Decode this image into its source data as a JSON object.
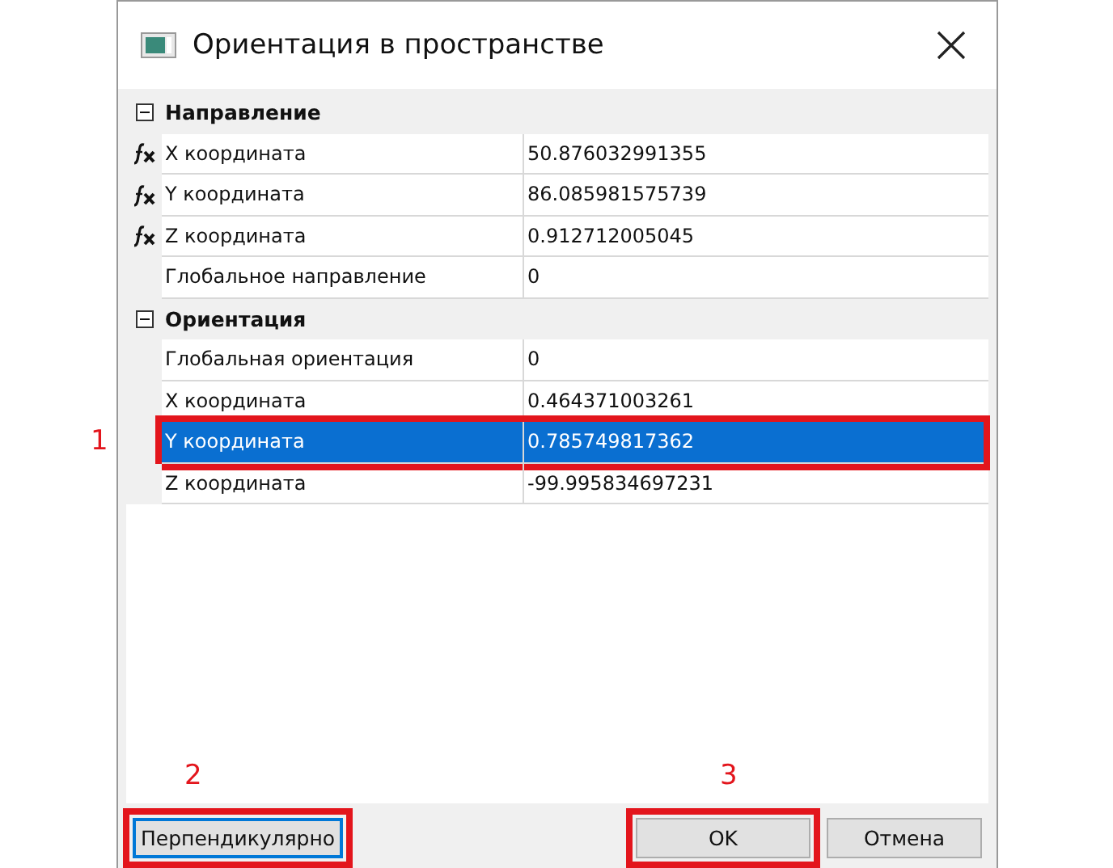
{
  "window": {
    "title": "Ориентация в пространстве"
  },
  "sections": [
    {
      "title": "Направление",
      "expanded": true,
      "rows": [
        {
          "name": "X координата",
          "value": "50.876032991355",
          "formula": true,
          "selected": false
        },
        {
          "name": "Y координата",
          "value": "86.085981575739",
          "formula": true,
          "selected": false
        },
        {
          "name": "Z координата",
          "value": "0.912712005045",
          "formula": true,
          "selected": false
        },
        {
          "name": "Глобальное направление",
          "value": "0",
          "formula": false,
          "selected": false
        }
      ]
    },
    {
      "title": "Ориентация",
      "expanded": true,
      "rows": [
        {
          "name": "Глобальная ориентация",
          "value": "0",
          "formula": false,
          "selected": false
        },
        {
          "name": "X координата",
          "value": "0.464371003261",
          "formula": false,
          "selected": false
        },
        {
          "name": "Y координата",
          "value": "0.785749817362",
          "formula": false,
          "selected": true,
          "annotation": "1"
        },
        {
          "name": "Z координата",
          "value": "-99.995834697231",
          "formula": false,
          "selected": false
        }
      ]
    }
  ],
  "buttons": [
    {
      "label": "Перпендикулярно",
      "focused": true,
      "annotation": "2"
    },
    {
      "label": "OK",
      "focused": false,
      "annotation": "3"
    },
    {
      "label": "Отмена",
      "focused": false
    }
  ]
}
